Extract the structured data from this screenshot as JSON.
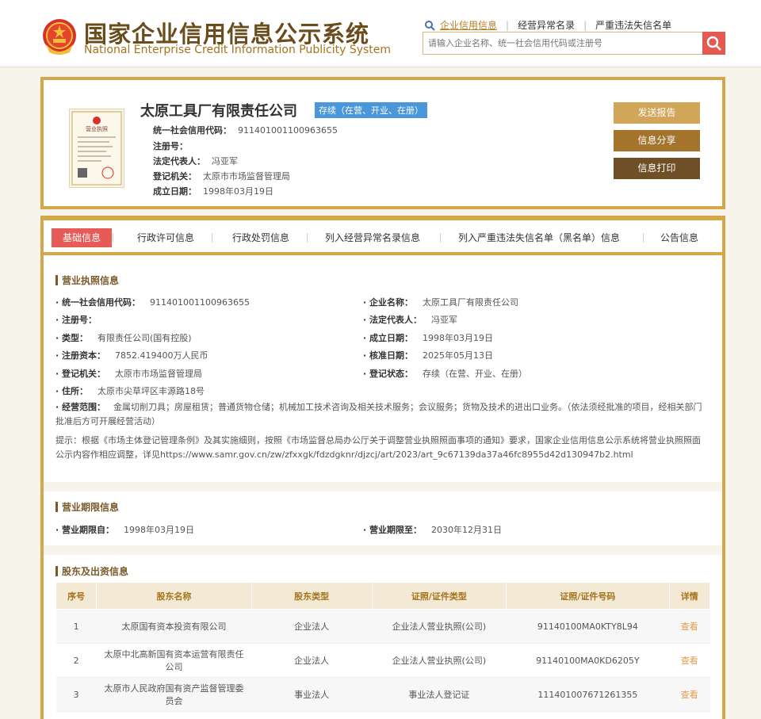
{
  "header": {
    "title_cn": "国家企业信用信息公示系统",
    "title_en": "National Enterprise Credit Information Publicity System",
    "nav": [
      {
        "label": "企业信用信息",
        "active": true
      },
      {
        "label": "经营异常名录",
        "active": false
      },
      {
        "label": "严重违法失信名单",
        "active": false
      }
    ],
    "search_placeholder": "请输入企业名称、统一社会信用代码或注册号"
  },
  "company": {
    "name": "太原工具厂有限责任公司",
    "status": "存续（在营、开业、在册）",
    "fields": [
      {
        "label": "统一社会信用代码：",
        "value": "911401001100963655"
      },
      {
        "label": "注册号：",
        "value": ""
      },
      {
        "label": "法定代表人：",
        "value": "冯亚军"
      },
      {
        "label": "登记机关：",
        "value": "太原市市场监督管理局"
      },
      {
        "label": "成立日期：",
        "value": "1998年03月19日"
      }
    ],
    "buttons": {
      "report": "发送报告",
      "share": "信息分享",
      "print": "信息打印"
    },
    "license_label": "营业执照"
  },
  "tabs": [
    {
      "label": "基础信息",
      "active": true
    },
    {
      "label": "行政许可信息",
      "active": false
    },
    {
      "label": "行政处罚信息",
      "active": false
    },
    {
      "label": "列入经营异常名录信息",
      "active": false
    },
    {
      "label": "列入严重违法失信名单（黑名单）信息",
      "active": false
    },
    {
      "label": "公告信息",
      "active": false
    }
  ],
  "license_section": {
    "title": "营业执照信息",
    "left": [
      {
        "label": "· 统一社会信用代码：",
        "value": "911401001100963655"
      },
      {
        "label": "· 注册号：",
        "value": ""
      },
      {
        "label": "· 类型：",
        "value": "有限责任公司(国有控股)"
      },
      {
        "label": "· 注册资本：",
        "value": "7852.419400万人民币"
      },
      {
        "label": "· 登记机关：",
        "value": "太原市市场监督管理局"
      },
      {
        "label": "· 住所：",
        "value": "太原市尖草坪区丰源路18号"
      }
    ],
    "right": [
      {
        "label": "· 企业名称：",
        "value": "太原工具厂有限责任公司"
      },
      {
        "label": "· 法定代表人：",
        "value": "冯亚军"
      },
      {
        "label": "· 成立日期：",
        "value": "1998年03月19日"
      },
      {
        "label": "· 核准日期：",
        "value": "2025年05月13日"
      },
      {
        "label": "· 登记状态：",
        "value": "存续（在营、开业、在册）"
      }
    ],
    "scope_label": "· 经营范围：",
    "scope_value": "金属切削刀具；房屋租赁；普通货物仓储；机械加工技术咨询及相关技术服务；会议服务；货物及技术的进出口业务。（依法须经批准的项目，经相关部门批准后方可开展经营活动）",
    "notice": "提示：根据《市场主体登记管理条例》及其实施细则，按照《市场监督总局办公厅关于调整营业执照照面事项的通知》要求，国家企业信用信息公示系统将营业执照照面公示内容作相应调整，详见https://www.samr.gov.cn/zw/zfxxgk/fdzdgknr/djzcj/art/2023/art_9c67139da37a46fc8955d42d130947b2.html"
  },
  "term_section": {
    "title": "营业期限信息",
    "from_label": "· 营业期限自：",
    "from_value": "1998年03月19日",
    "to_label": "· 营业期限至：",
    "to_value": "2030年12月31日"
  },
  "shareholders": {
    "title": "股东及出资信息",
    "columns": [
      "序号",
      "股东名称",
      "股东类型",
      "证照/证件类型",
      "证照/证件号码",
      "详情"
    ],
    "rows": [
      [
        "1",
        "太原国有资本投资有限公司",
        "企业法人",
        "企业法人营业执照(公司)",
        "91140100MA0KTY8L94",
        "查看"
      ],
      [
        "2",
        "太原中北高新国有资本运营有限责任公司",
        "企业法人",
        "企业法人营业执照(公司)",
        "91140100MA0KD6205Y",
        "查看"
      ],
      [
        "3",
        "太原市人民政府国有资产监督管理委员会",
        "事业法人",
        "事业法人登记证",
        "111401007671261355",
        "查看"
      ]
    ]
  },
  "colors": {
    "gold": "#d4a84a",
    "brown": "#6b4c1c",
    "red": "#e65b57",
    "blue_badge": "#4a97d9"
  }
}
